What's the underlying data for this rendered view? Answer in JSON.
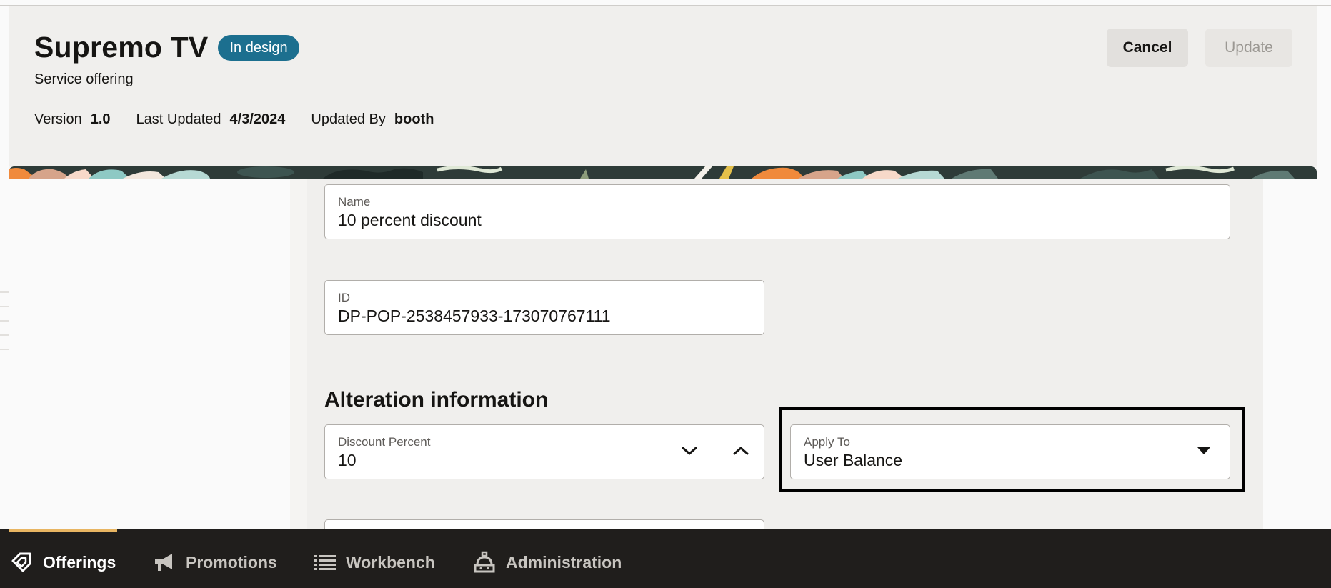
{
  "header": {
    "title": "Supremo TV",
    "status": "In design",
    "subtitle": "Service offering",
    "meta": [
      {
        "label": "Version",
        "value": "1.0"
      },
      {
        "label": "Last Updated",
        "value": "4/3/2024"
      },
      {
        "label": "Updated By",
        "value": "booth"
      }
    ],
    "cancel_label": "Cancel",
    "update_label": "Update"
  },
  "form": {
    "name": {
      "label": "Name",
      "value": "10 percent discount"
    },
    "id": {
      "label": "ID",
      "value": "DP-POP-2538457933-173070767111"
    },
    "section_title": "Alteration information",
    "discount_percent": {
      "label": "Discount Percent",
      "value": "10"
    },
    "apply_to": {
      "label": "Apply To",
      "value": "User Balance"
    }
  },
  "nav": {
    "items": [
      {
        "label": "Offerings",
        "icon": "tag-icon",
        "active": true
      },
      {
        "label": "Promotions",
        "icon": "megaphone-icon",
        "active": false
      },
      {
        "label": "Workbench",
        "icon": "list-icon",
        "active": false
      },
      {
        "label": "Administration",
        "icon": "admin-icon",
        "active": false
      }
    ]
  },
  "colors": {
    "badge": "#1c6f8f",
    "nav_background": "#201e1c",
    "nav_active_indicator": "#e8b562"
  }
}
